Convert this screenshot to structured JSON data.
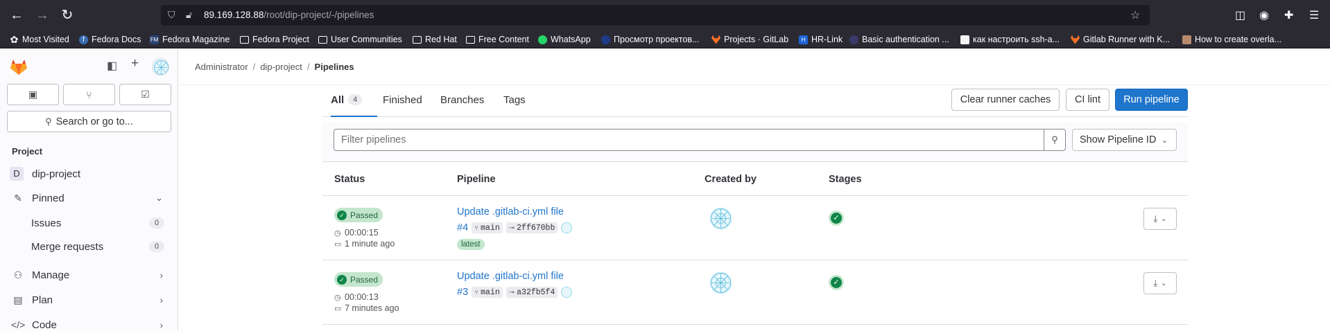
{
  "browser": {
    "url_host": "89.169.128.88",
    "url_path": "/root/dip-project/-/pipelines",
    "bookmarks": [
      {
        "label": "Most Visited",
        "icon": "star-icon"
      },
      {
        "label": "Fedora Docs",
        "icon": "fedora-icon"
      },
      {
        "label": "Fedora Magazine",
        "icon": "fedora-magazine-icon"
      },
      {
        "label": "Fedora Project",
        "icon": "folder-icon"
      },
      {
        "label": "User Communities",
        "icon": "folder-icon"
      },
      {
        "label": "Red Hat",
        "icon": "folder-icon"
      },
      {
        "label": "Free Content",
        "icon": "folder-icon"
      },
      {
        "label": "WhatsApp",
        "icon": "whatsapp-icon"
      },
      {
        "label": "Просмотр проектов...",
        "icon": "yandex-icon"
      },
      {
        "label": "Projects · GitLab",
        "icon": "gitlab-icon"
      },
      {
        "label": "HR-Link",
        "icon": "hrlink-icon"
      },
      {
        "label": "Basic authentication ...",
        "icon": "site-icon"
      },
      {
        "label": "как настроить ssh-a...",
        "icon": "tux-icon"
      },
      {
        "label": "Gitlab Runner with K...",
        "icon": "gitlab-icon"
      },
      {
        "label": "How to create overla...",
        "icon": "image-icon"
      }
    ]
  },
  "sidebar": {
    "search_label": "Search or go to...",
    "section_title": "Project",
    "project_letter": "D",
    "project_name": "dip-project",
    "pinned_label": "Pinned",
    "issues_label": "Issues",
    "issues_count": "0",
    "mr_label": "Merge requests",
    "mr_count": "0",
    "manage_label": "Manage",
    "plan_label": "Plan",
    "code_label": "Code"
  },
  "breadcrumb": {
    "items": [
      "Administrator",
      "dip-project",
      "Pipelines"
    ]
  },
  "tabs": {
    "all_label": "All",
    "all_count": "4",
    "finished_label": "Finished",
    "branches_label": "Branches",
    "tags_label": "Tags"
  },
  "actions": {
    "clear_cache": "Clear runner caches",
    "ci_lint": "CI lint",
    "run_pipeline": "Run pipeline"
  },
  "filter": {
    "placeholder": "Filter pipelines",
    "dropdown_label": "Show Pipeline ID"
  },
  "table": {
    "columns": [
      "Status",
      "Pipeline",
      "Created by",
      "Stages"
    ],
    "rows": [
      {
        "status": "Passed",
        "duration": "00:00:15",
        "finished": "1 minute ago",
        "title": "Update .gitlab-ci.yml file",
        "id": "#4",
        "branch": "main",
        "commit": "2ff670bb",
        "badge": "latest"
      },
      {
        "status": "Passed",
        "duration": "00:00:13",
        "finished": "7 minutes ago",
        "title": "Update .gitlab-ci.yml file",
        "id": "#3",
        "branch": "main",
        "commit": "a32fb5f4",
        "badge": ""
      }
    ]
  },
  "colors": {
    "accent": "#1f75cb",
    "success": "#108548",
    "success_bg": "#c3e6cd",
    "browser_chrome": "#2b2a33"
  }
}
